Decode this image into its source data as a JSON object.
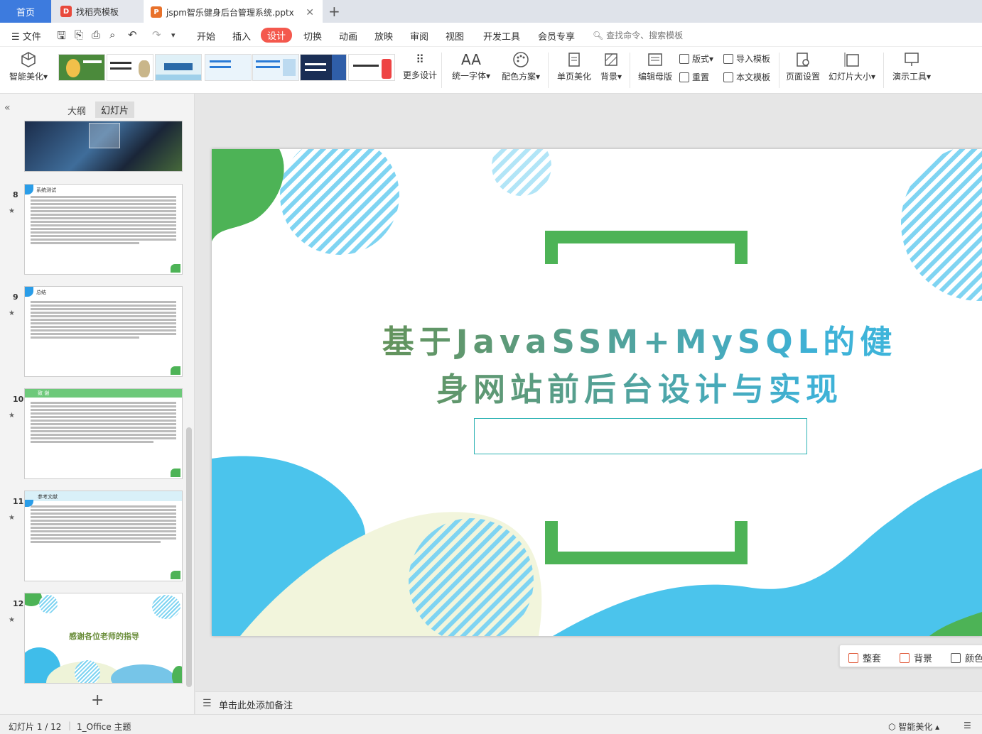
{
  "tabs": {
    "home": "首页",
    "docer": "找稻壳模板",
    "file": "jspm智乐健身后台管理系统.pptx"
  },
  "menu": {
    "file": "文件",
    "items": [
      "开始",
      "插入",
      "设计",
      "切换",
      "动画",
      "放映",
      "审阅",
      "视图",
      "开发工具",
      "会员专享"
    ],
    "search_placeholder": "查找命令、搜索模板"
  },
  "ribbon": {
    "smart_beautify": "智能美化",
    "more_design": "更多设计",
    "unify_font": "统一字体",
    "color_scheme": "配色方案",
    "page_beautify": "单页美化",
    "background": "背景",
    "edit_master": "编辑母版",
    "layout": "版式",
    "reset": "重置",
    "import_template": "导入模板",
    "doc_template": "本文模板",
    "page_setup": "页面设置",
    "slide_size": "幻灯片大小",
    "present_tools": "演示工具",
    "template_thumbs": [
      "template-1",
      "template-2",
      "template-3",
      "template-4",
      "template-5",
      "template-6",
      "template-7"
    ]
  },
  "panel": {
    "outline_tab": "大纲",
    "slides_tab": "幻灯片",
    "slides": [
      {
        "num": "8",
        "title": "系统测试"
      },
      {
        "num": "9",
        "title": "总结"
      },
      {
        "num": "10",
        "title": "致 谢"
      },
      {
        "num": "11",
        "title": "参考文献"
      },
      {
        "num": "12",
        "title": "感谢各位老师的指导"
      }
    ]
  },
  "slide": {
    "title_line1": "基于JavaSSM+MySQL的健",
    "title_line2": "身网站前后台设计与实现",
    "colors": {
      "green": "#4db356",
      "blue": "#3fbdea",
      "stripe": "#6fd0f0",
      "cream": "#f2f5dc"
    }
  },
  "quickbar": {
    "tidy": "整套",
    "background": "背景",
    "color": "颜色"
  },
  "notes": {
    "placeholder": "单击此处添加备注"
  },
  "status": {
    "slide_counter": "幻灯片 1 / 12",
    "theme": "1_Office 主题",
    "smart_beautify": "智能美化"
  }
}
